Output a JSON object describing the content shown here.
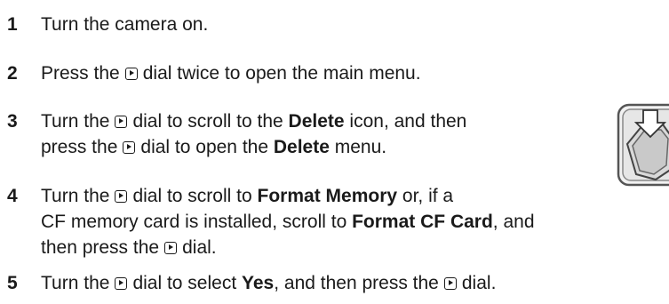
{
  "steps": [
    {
      "number": "1",
      "lines": [
        [
          "Turn the camera on."
        ]
      ]
    },
    {
      "number": "2",
      "lines": [
        [
          "Press the",
          "dial twice to open the main menu."
        ]
      ]
    },
    {
      "number": "3",
      "lines": [
        [
          "Turn the",
          "dial to scroll to the",
          "Delete",
          "icon, and then"
        ],
        [
          "press the",
          "dial to open the",
          "Delete",
          "menu."
        ]
      ]
    },
    {
      "number": "4",
      "lines": [
        [
          "Turn the",
          "dial to scroll to",
          "Format Memory",
          "or, if a"
        ],
        [
          "CF memory card is installed, scroll to",
          "Format CF Card",
          ", and"
        ],
        [
          "then press the",
          "dial."
        ]
      ]
    },
    {
      "number": "5",
      "lines": [
        [
          "Turn the",
          "dial to select",
          "Yes",
          ", and then press the",
          "dial."
        ]
      ]
    }
  ],
  "icons": {
    "dial": "playback-dial-icon",
    "side_image": "delete-menu-icon"
  }
}
